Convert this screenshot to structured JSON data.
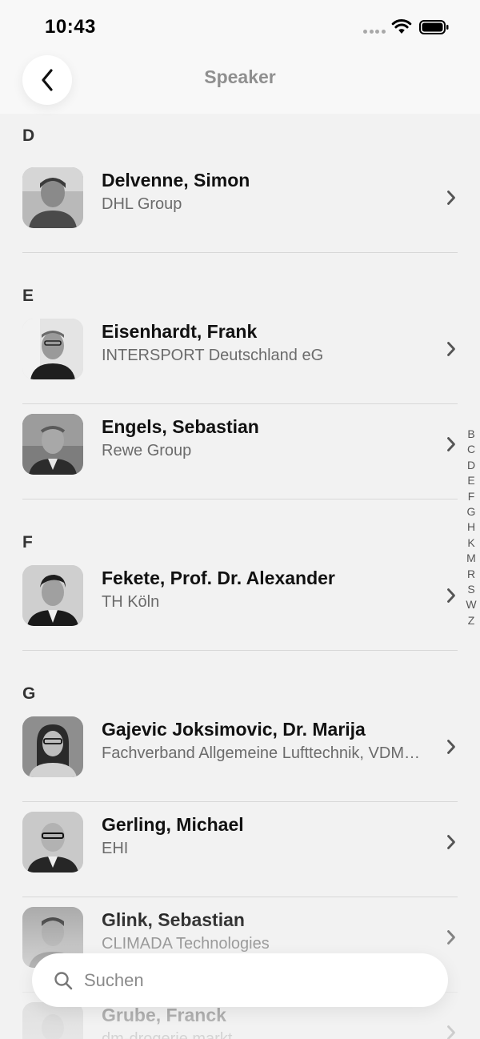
{
  "status_bar": {
    "time": "10:43"
  },
  "nav": {
    "title": "Speaker"
  },
  "sections": [
    {
      "letter": "D",
      "items": [
        {
          "name": "Delvenne, Simon",
          "org": "DHL Group"
        }
      ]
    },
    {
      "letter": "E",
      "items": [
        {
          "name": "Eisenhardt, Frank",
          "org": "INTERSPORT Deutschland eG"
        },
        {
          "name": "Engels, Sebastian",
          "org": "Rewe Group"
        }
      ]
    },
    {
      "letter": "F",
      "items": [
        {
          "name": "Fekete, Prof. Dr. Alexander",
          "org": "TH Köln"
        }
      ]
    },
    {
      "letter": "G",
      "items": [
        {
          "name": "Gajevic Joksimovic, Dr. Marija",
          "org": "Fachverband Allgemeine Lufttechnik, VDMA e.V."
        },
        {
          "name": "Gerling, Michael",
          "org": "EHI"
        },
        {
          "name": "Glink, Sebastian",
          "org": "CLIMADA Technologies"
        },
        {
          "name": "Grube, Franck",
          "org": "dm-drogerie markt"
        }
      ]
    }
  ],
  "index_letters": [
    "B",
    "C",
    "D",
    "E",
    "F",
    "G",
    "H",
    "K",
    "M",
    "R",
    "S",
    "W",
    "Z"
  ],
  "search": {
    "placeholder": "Suchen"
  }
}
